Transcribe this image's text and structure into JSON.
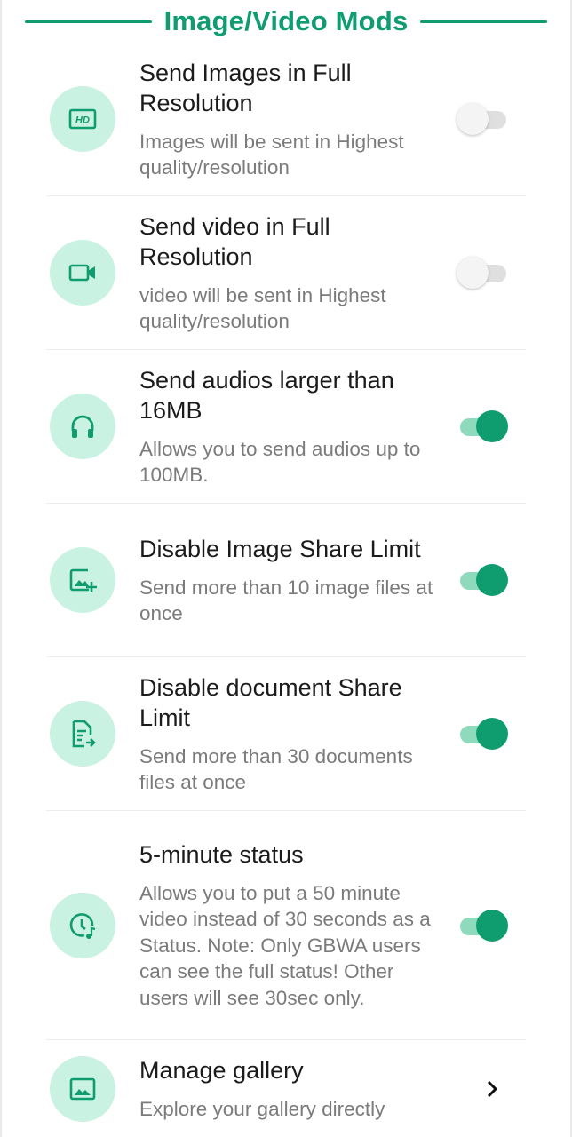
{
  "section": {
    "title": "Image/Video Mods"
  },
  "colors": {
    "accent": "#0f9c6f",
    "icon_bg": "#c9f2e2",
    "toggle_on_track": "#8fd9bd"
  },
  "items": [
    {
      "icon": "hd-icon",
      "title": "Send Images in Full Resolution",
      "subtitle": "Images will be sent in Highest quality/resolution",
      "control": "toggle",
      "enabled": false
    },
    {
      "icon": "video-camera-icon",
      "title": "Send video in Full Resolution",
      "subtitle": "video will be sent in Highest quality/resolution",
      "control": "toggle",
      "enabled": false
    },
    {
      "icon": "headphones-icon",
      "title": "Send audios larger than 16MB",
      "subtitle": "Allows you to send audios up to 100MB.",
      "control": "toggle",
      "enabled": true
    },
    {
      "icon": "add-photo-icon",
      "title": "Disable Image Share Limit",
      "subtitle": "Send more than 10 image files at once",
      "control": "toggle",
      "enabled": true
    },
    {
      "icon": "document-send-icon",
      "title": "Disable document Share Limit",
      "subtitle": "Send more than 30 documents files at once",
      "control": "toggle",
      "enabled": true
    },
    {
      "icon": "clock-music-icon",
      "title": "5-minute status",
      "subtitle": "Allows you to put a 50 minute video instead of 30 seconds as a Status. Note: Only GBWA users can see the full status! Other users will see 30sec only.",
      "control": "toggle",
      "enabled": true
    },
    {
      "icon": "gallery-icon",
      "title": "Manage gallery",
      "subtitle": "Explore your gallery directly",
      "control": "chevron",
      "enabled": null
    }
  ]
}
